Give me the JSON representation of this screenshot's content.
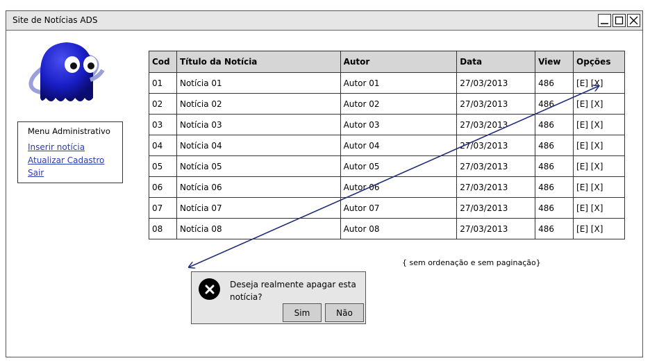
{
  "window": {
    "title": "Site de Notícias ADS"
  },
  "menu": {
    "title": "Menu Administrativo",
    "links": [
      "Inserir notícia",
      "Atualizar Cadastro",
      "Sair"
    ]
  },
  "table": {
    "headers": [
      "Cod",
      "Título da Notícia",
      "Autor",
      "Data",
      "View",
      "Opções"
    ],
    "rows": [
      [
        "01",
        "Notícia 01",
        "Autor 01",
        "27/03/2013",
        "486",
        "[E] [X]"
      ],
      [
        "02",
        "Notícia 02",
        "Autor 02",
        "27/03/2013",
        "486",
        "[E] [X]"
      ],
      [
        "03",
        "Notícia 03",
        "Autor 03",
        "27/03/2013",
        "486",
        "[E] [X]"
      ],
      [
        "04",
        "Notícia 04",
        "Autor 04",
        "27/03/2013",
        "486",
        "[E] [X]"
      ],
      [
        "05",
        "Notícia 05",
        "Autor 05",
        "27/03/2013",
        "486",
        "[E] [X]"
      ],
      [
        "06",
        "Notícia 06",
        "Autor 06",
        "27/03/2013",
        "486",
        "[E] [X]"
      ],
      [
        "07",
        "Notícia 07",
        "Autor 07",
        "27/03/2013",
        "486",
        "[E] [X]"
      ],
      [
        "08",
        "Notícia 08",
        "Autor 08",
        "27/03/2013",
        "486",
        "[E] [X]"
      ]
    ]
  },
  "note": "{ sem ordenação e sem paginação}",
  "dialog": {
    "message": "Deseja realmente apagar esta notícia?",
    "confirm_label": "Sim",
    "cancel_label": "Não",
    "icon": "close-circle-icon"
  },
  "colors": {
    "link": "#2b3bb0",
    "arrow": "#1f2d7a",
    "header_bg": "#d6d6d6",
    "titlebar_bg": "#e6e6e6"
  }
}
